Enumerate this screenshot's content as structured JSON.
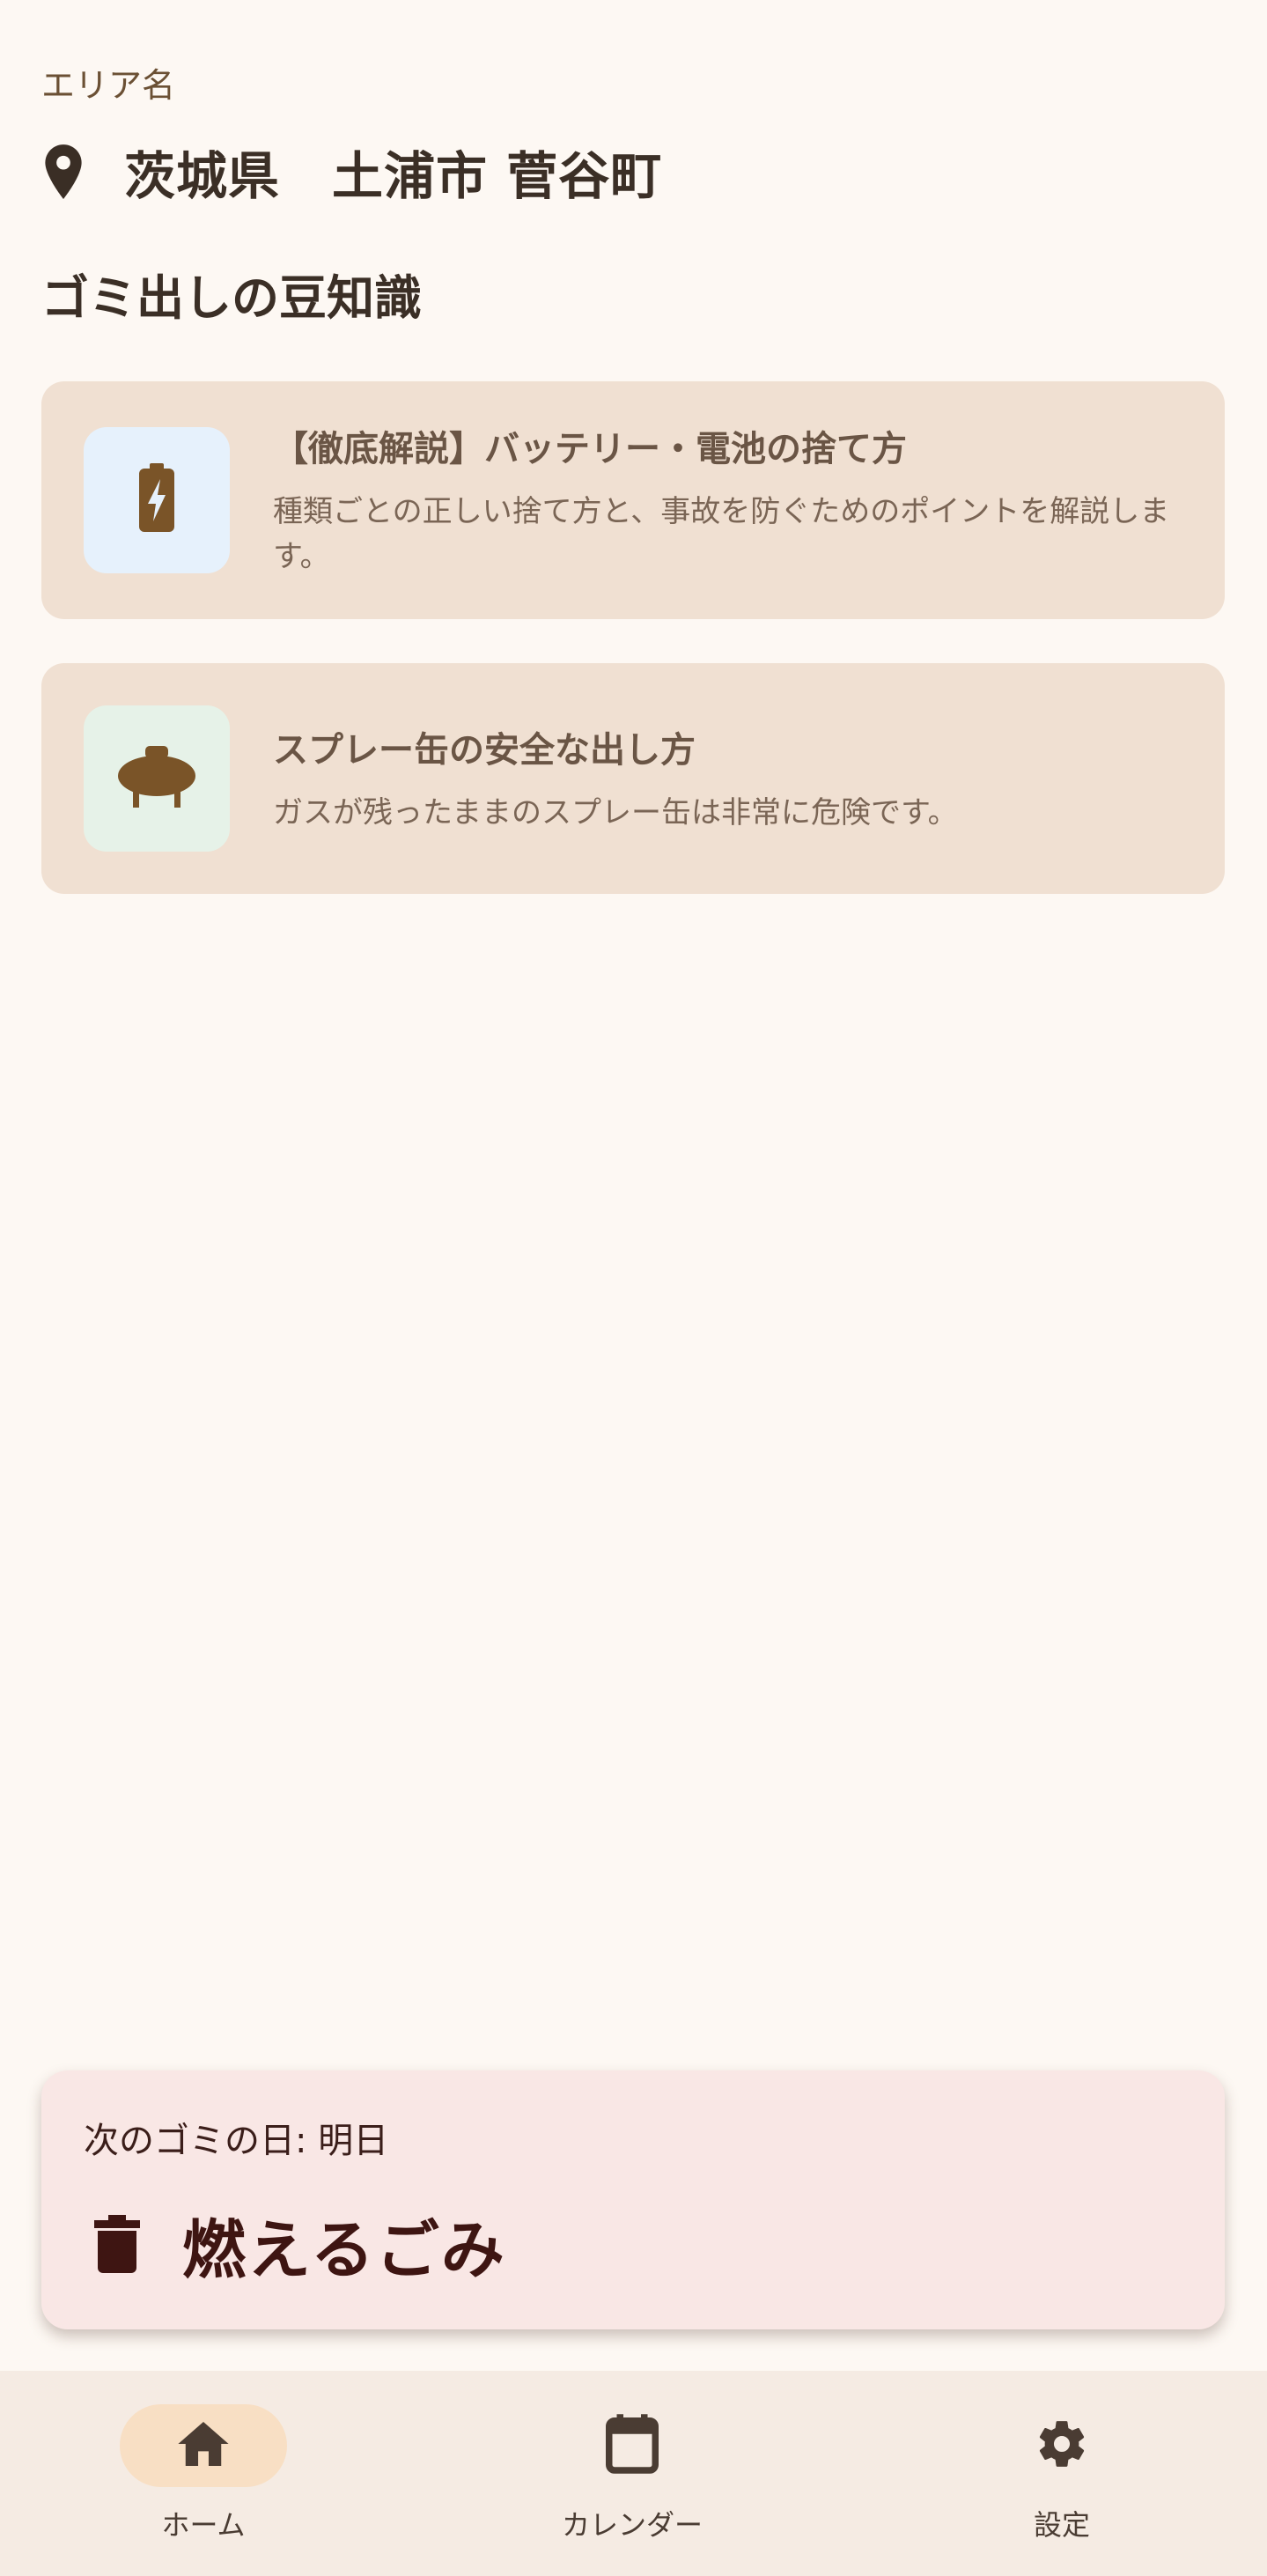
{
  "area": {
    "label": "エリア名",
    "name": "茨城県　土浦市 菅谷町"
  },
  "tips": {
    "section_title": "ゴミ出しの豆知識",
    "items": [
      {
        "icon": "battery-charging-icon",
        "icon_bg": "#e6f1fc",
        "title": "【徹底解説】バッテリー・電池の捨て方",
        "description": "種類ごとの正しい捨て方と、事故を防ぐためのポイントを解説します。"
      },
      {
        "icon": "gas-tank-icon",
        "icon_bg": "#e6f2e8",
        "title": "スプレー缶の安全な出し方",
        "description": "ガスが残ったままのスプレー缶は非常に危険です。"
      }
    ]
  },
  "next_collection": {
    "label": "次のゴミの日: 明日",
    "type": "燃えるごみ",
    "icon": "trash-icon"
  },
  "bottom_nav": {
    "items": [
      {
        "label": "ホーム",
        "icon": "home-icon",
        "selected": true
      },
      {
        "label": "カレンダー",
        "icon": "calendar-icon",
        "selected": false
      },
      {
        "label": "設定",
        "icon": "gear-icon",
        "selected": false
      }
    ]
  },
  "colors": {
    "background": "#fdf8f3",
    "card": "#f0e0d2",
    "accent_brown": "#7a5428",
    "next_card": "#f9e7e5",
    "nav_bg": "#f5ebe3",
    "nav_selected": "#f8dfc4"
  }
}
